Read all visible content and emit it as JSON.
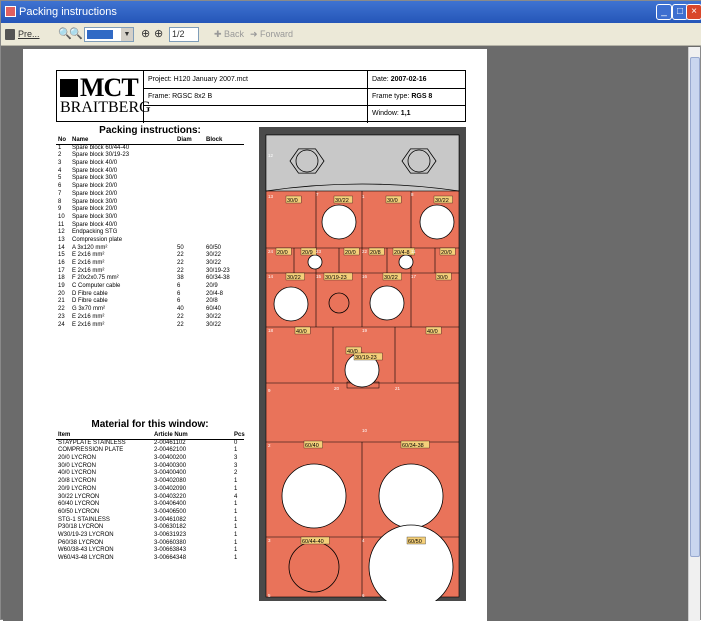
{
  "window": {
    "title": "Packing instructions"
  },
  "toolbar": {
    "print_label": "Pre...",
    "zoom_value": "",
    "page_value": "1/2",
    "back_label": "Back",
    "forward_label": "Forward"
  },
  "header": {
    "logo_line1": "MCT",
    "logo_line2": "BRAITBERG",
    "project": "Project: H120 January 2007.mct",
    "frame": "Frame: RGSC 8x2 B",
    "date_label": "Date:",
    "date": "2007-02-16",
    "frame_type_label": "Frame type:",
    "frame_type": "RGS 8",
    "window_label": "Window:",
    "window": "1,1"
  },
  "packing": {
    "title": "Packing instructions:",
    "columns": [
      "No",
      "Name",
      "Diam",
      "Block"
    ],
    "rows": [
      [
        "1",
        "Spare block 60/44-40",
        "",
        ""
      ],
      [
        "2",
        "Spare block 30/19-23",
        "",
        ""
      ],
      [
        "3",
        "Spare block 40/0",
        "",
        ""
      ],
      [
        "4",
        "Spare block 40/0",
        "",
        ""
      ],
      [
        "5",
        "Spare block 30/0",
        "",
        ""
      ],
      [
        "6",
        "Spare block 20/0",
        "",
        ""
      ],
      [
        "7",
        "Spare block 20/0",
        "",
        ""
      ],
      [
        "8",
        "Spare block 30/0",
        "",
        ""
      ],
      [
        "9",
        "Spare block 20/0",
        "",
        ""
      ],
      [
        "10",
        "Spare block 30/0",
        "",
        ""
      ],
      [
        "11",
        "Spare block 40/0",
        "",
        ""
      ],
      [
        "12",
        "Endpacking STG",
        "",
        ""
      ],
      [
        "13",
        "Compression plate",
        "",
        ""
      ],
      [
        "14",
        "A 3x120 mm²",
        "50",
        "60/50"
      ],
      [
        "15",
        "E 2x16 mm²",
        "22",
        "30/22"
      ],
      [
        "16",
        "E 2x16 mm²",
        "22",
        "30/22"
      ],
      [
        "17",
        "E 2x16 mm²",
        "22",
        "30/19-23"
      ],
      [
        "18",
        "F 20x2x0.75 mm²",
        "38",
        "60/34-38"
      ],
      [
        "19",
        "C Computer cable",
        "6",
        "20/9"
      ],
      [
        "20",
        "D Fibre cable",
        "6",
        "20/4-8"
      ],
      [
        "21",
        "D Fibre cable",
        "6",
        "20/8"
      ],
      [
        "22",
        "G 3x70 mm²",
        "40",
        "60/40"
      ],
      [
        "23",
        "E 2x16 mm²",
        "22",
        "30/22"
      ],
      [
        "24",
        "E 2x16 mm²",
        "22",
        "30/22"
      ]
    ]
  },
  "material": {
    "title": "Material for this window:",
    "columns": [
      "Item",
      "Article Num",
      "Pcs"
    ],
    "rows": [
      [
        "STAYPLATE STAINLESS",
        "2-00461102",
        "0"
      ],
      [
        "COMPRESSION PLATE",
        "2-00462100",
        "1"
      ],
      [
        "20/0 LYCRON",
        "3-00400200",
        "3"
      ],
      [
        "30/0 LYCRON",
        "3-00400300",
        "3"
      ],
      [
        "40/0 LYCRON",
        "3-00400400",
        "2"
      ],
      [
        "20/8 LYCRON",
        "3-00402080",
        "1"
      ],
      [
        "20/9 LYCRON",
        "3-00402090",
        "1"
      ],
      [
        "30/22 LYCRON",
        "3-00403220",
        "4"
      ],
      [
        "60/40 LYCRON",
        "3-00406400",
        "1"
      ],
      [
        "60/50 LYCRON",
        "3-00406500",
        "1"
      ],
      [
        "STG-1 STAINLESS",
        "3-00461082",
        "1"
      ],
      [
        "P30/18 LYCRON",
        "3-00630182",
        "1"
      ],
      [
        "W30/19-23 LYCRON",
        "3-00631923",
        "1"
      ],
      [
        "P60/38 LYCRON",
        "3-00660380",
        "1"
      ],
      [
        "W60/38-43 LYCRON",
        "3-00663843",
        "1"
      ],
      [
        "W60/43-48 LYCRON",
        "3-00664348",
        "1"
      ]
    ]
  },
  "drawing": {
    "labels": {
      "b1a": "30/0",
      "b1b": "30/22",
      "b1c": "30/0",
      "b1d": "30/22",
      "b2a": "20/0",
      "b2b": "20/9",
      "b2c": "20/0",
      "b2d": "20/8",
      "b2e": "20/4-8",
      "b2f": "20/0",
      "b3a": "30/22",
      "b3b": "30/19-23",
      "b3c": "30/22",
      "b3d": "30/0",
      "b4a": "40/0",
      "b4b": "40/0",
      "b4c": "30/19-23",
      "b4d": "40/0",
      "b5a": "60/40",
      "b5b": "60/34-38",
      "b6a": "60/44-40",
      "b6b": "60/50"
    },
    "markers": [
      "12",
      "13",
      "1",
      "24",
      "23",
      "22",
      "11",
      "14",
      "15",
      "16",
      "17",
      "18",
      "19",
      "20",
      "21",
      "2",
      "3",
      "4",
      "5",
      "6",
      "7",
      "8",
      "9",
      "10"
    ],
    "colors": {
      "block": "#e9735a",
      "frame": "#4a4a4a",
      "top": "#c8c8c8"
    }
  }
}
